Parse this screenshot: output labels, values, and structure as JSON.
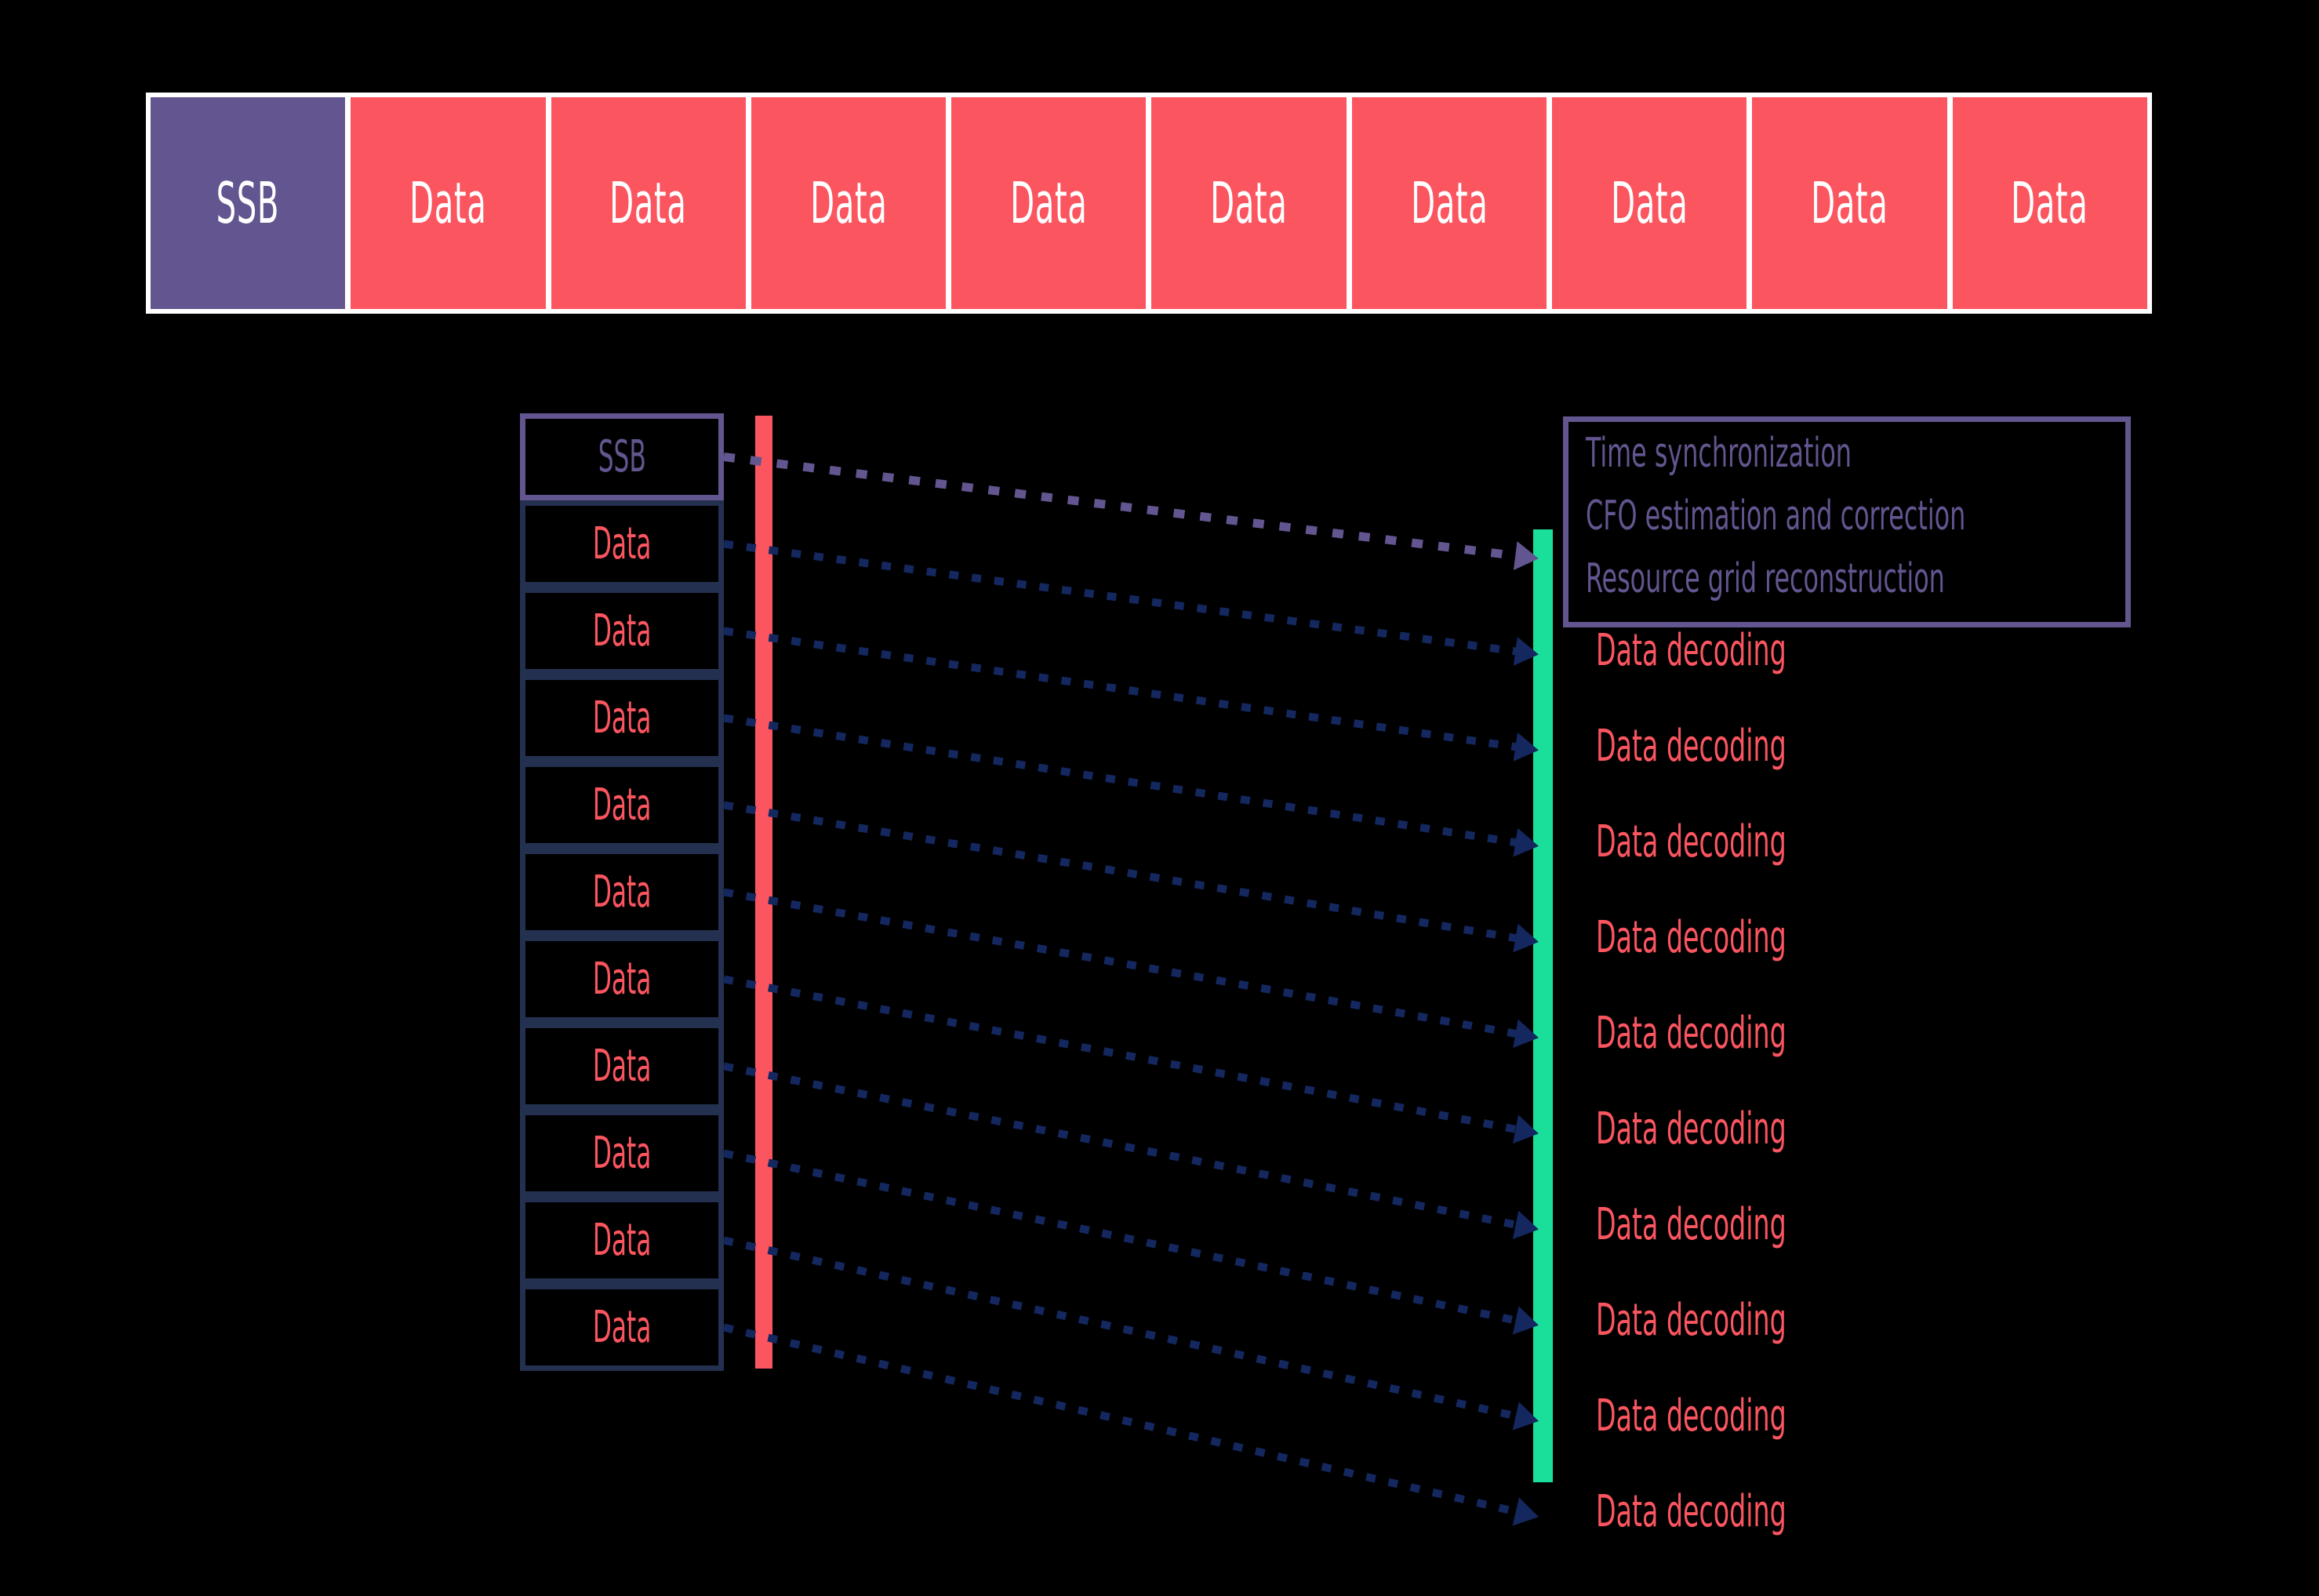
{
  "colors": {
    "background": "#000000",
    "ssb_purple": "#63558F",
    "data_red": "#FB5560",
    "arrow_navy": "#14275E",
    "box_navy": "#24304F",
    "rx_green": "#1ADF9B",
    "strip_white": "#FFFFFF"
  },
  "top_strip": {
    "slots": [
      {
        "label": "SSB",
        "type": "ssb"
      },
      {
        "label": "Data",
        "type": "data"
      },
      {
        "label": "Data",
        "type": "data"
      },
      {
        "label": "Data",
        "type": "data"
      },
      {
        "label": "Data",
        "type": "data"
      },
      {
        "label": "Data",
        "type": "data"
      },
      {
        "label": "Data",
        "type": "data"
      },
      {
        "label": "Data",
        "type": "data"
      },
      {
        "label": "Data",
        "type": "data"
      },
      {
        "label": "Data",
        "type": "data"
      }
    ]
  },
  "sequence_column": {
    "rows": [
      {
        "label": "SSB",
        "type": "ssb"
      },
      {
        "label": "Data",
        "type": "data"
      },
      {
        "label": "Data",
        "type": "data"
      },
      {
        "label": "Data",
        "type": "data"
      },
      {
        "label": "Data",
        "type": "data"
      },
      {
        "label": "Data",
        "type": "data"
      },
      {
        "label": "Data",
        "type": "data"
      },
      {
        "label": "Data",
        "type": "data"
      },
      {
        "label": "Data",
        "type": "data"
      },
      {
        "label": "Data",
        "type": "data"
      },
      {
        "label": "Data",
        "type": "data"
      }
    ]
  },
  "legend": {
    "lines": [
      "Time synchronization",
      "CFO estimation and correction",
      "Resource grid reconstruction"
    ]
  },
  "decoding_labels": [
    "Data decoding",
    "Data decoding",
    "Data decoding",
    "Data decoding",
    "Data decoding",
    "Data decoding",
    "Data decoding",
    "Data decoding",
    "Data decoding",
    "Data decoding"
  ]
}
